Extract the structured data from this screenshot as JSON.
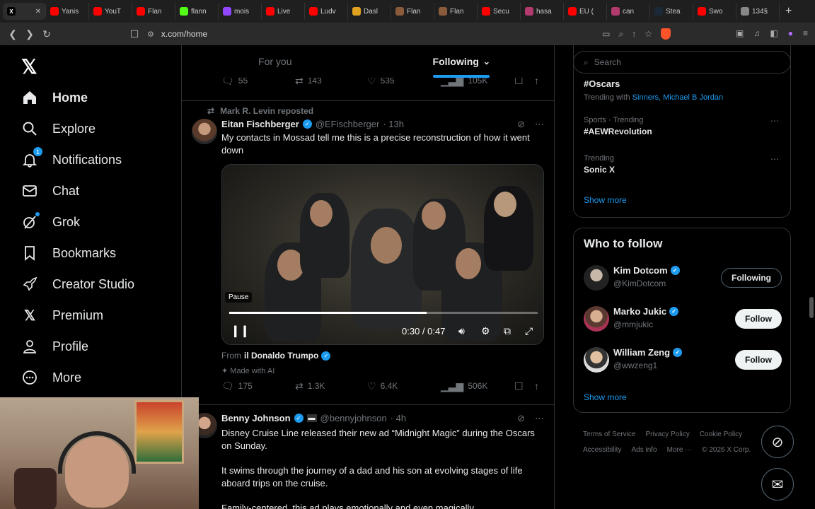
{
  "browser": {
    "tabs": [
      {
        "label": "",
        "icon": "x-logo",
        "color": "#000000"
      },
      {
        "label": "Yanis",
        "icon": "youtube",
        "color": "#ff0000"
      },
      {
        "label": "YouT",
        "icon": "youtube",
        "color": "#ff0000"
      },
      {
        "label": "Flan",
        "icon": "youtube",
        "color": "#ff0000"
      },
      {
        "label": "flann",
        "icon": "kick",
        "color": "#53fc18"
      },
      {
        "label": "mois",
        "icon": "twitch",
        "color": "#9146ff"
      },
      {
        "label": "Live",
        "icon": "youtube",
        "color": "#ff0000"
      },
      {
        "label": "Ludv",
        "icon": "youtube",
        "color": "#ff0000"
      },
      {
        "label": "Dasl",
        "icon": "smiley",
        "color": "#e0a020"
      },
      {
        "label": "Flan",
        "icon": "site",
        "color": "#8a5a3a"
      },
      {
        "label": "Flan",
        "icon": "site",
        "color": "#8a5a3a"
      },
      {
        "label": "Secu",
        "icon": "youtube",
        "color": "#ff0000"
      },
      {
        "label": "hasa",
        "icon": "site",
        "color": "#b23a6d"
      },
      {
        "label": "EU (",
        "icon": "youtube",
        "color": "#ff0000"
      },
      {
        "label": "can",
        "icon": "site",
        "color": "#b23a6d"
      },
      {
        "label": "Stea",
        "icon": "steam",
        "color": "#1b2838"
      },
      {
        "label": "Swo",
        "icon": "youtube",
        "color": "#ff0000"
      },
      {
        "label": "134§",
        "icon": "stack",
        "color": "#888888"
      }
    ],
    "url": "x.com/home"
  },
  "nav": {
    "items": [
      {
        "label": "Home",
        "icon": "home-icon"
      },
      {
        "label": "Explore",
        "icon": "search-icon"
      },
      {
        "label": "Notifications",
        "icon": "bell-icon",
        "badge": "1"
      },
      {
        "label": "Chat",
        "icon": "mail-icon"
      },
      {
        "label": "Grok",
        "icon": "grok-icon"
      },
      {
        "label": "Bookmarks",
        "icon": "bookmark-icon"
      },
      {
        "label": "Creator Studio",
        "icon": "rocket-icon"
      },
      {
        "label": "Premium",
        "icon": "x-icon"
      },
      {
        "label": "Profile",
        "icon": "person-icon"
      },
      {
        "label": "More",
        "icon": "more-icon"
      }
    ]
  },
  "feed": {
    "tab_for_you": "For you",
    "tab_following": "Following",
    "prev_actions": {
      "replies": "55",
      "reposts": "143",
      "likes": "535",
      "views": "105K"
    },
    "post1": {
      "repost_by": "Mark R. Levin reposted",
      "name": "Eitan Fischberger",
      "handle": "@EFischberger",
      "time": "· 13h",
      "text": "My contacts in Mossad tell me this is a precise reconstruction of how it went down",
      "video": {
        "tooltip": "Pause",
        "time": "0:30 / 0:47",
        "progress": 0.64
      },
      "from_prefix": "From",
      "from_name": "il Donaldo Trumpo",
      "ai_label": "Made with AI",
      "actions": {
        "replies": "175",
        "reposts": "1.3K",
        "likes": "6.4K",
        "views": "506K"
      }
    },
    "post2": {
      "name": "Benny Johnson",
      "handle": "@bennyjohnson",
      "time": "· 4h",
      "text1": "Disney Cruise Line released their new ad “Midnight Magic” during the Oscars on Sunday.",
      "text2": "It swims through the journey of a dad and his son at evolving stages of life aboard trips on the cruise.",
      "text3": "Family-centered, this ad plays emotionally and even magically"
    }
  },
  "sidebar": {
    "search_placeholder": "Search",
    "trend_top": {
      "name": "#Oscars",
      "with_prefix": "Trending with",
      "with_links": "Sinners, Michael B Jordan"
    },
    "trends": [
      {
        "category": "Sports · Trending",
        "name": "#AEWRevolution"
      },
      {
        "category": "Trending",
        "name": "Sonic X"
      }
    ],
    "show_more": "Show more",
    "who_to_follow": {
      "title": "Who to follow",
      "accounts": [
        {
          "name": "Kim Dotcom",
          "handle": "@KimDotcom",
          "button": "Following"
        },
        {
          "name": "Marko Jukic",
          "handle": "@mmjukic",
          "button": "Follow"
        },
        {
          "name": "William Zeng",
          "handle": "@wwzeng1",
          "button": "Follow"
        }
      ],
      "show_more": "Show more"
    },
    "footer": [
      "Terms of Service",
      "Privacy Policy",
      "Cookie Policy",
      "Accessibility",
      "Ads info",
      "More ···",
      "© 2026 X Corp."
    ]
  },
  "colors": {
    "accent": "#1d9bf0",
    "background": "#000000",
    "border": "#2f3336",
    "muted": "#71767b"
  }
}
